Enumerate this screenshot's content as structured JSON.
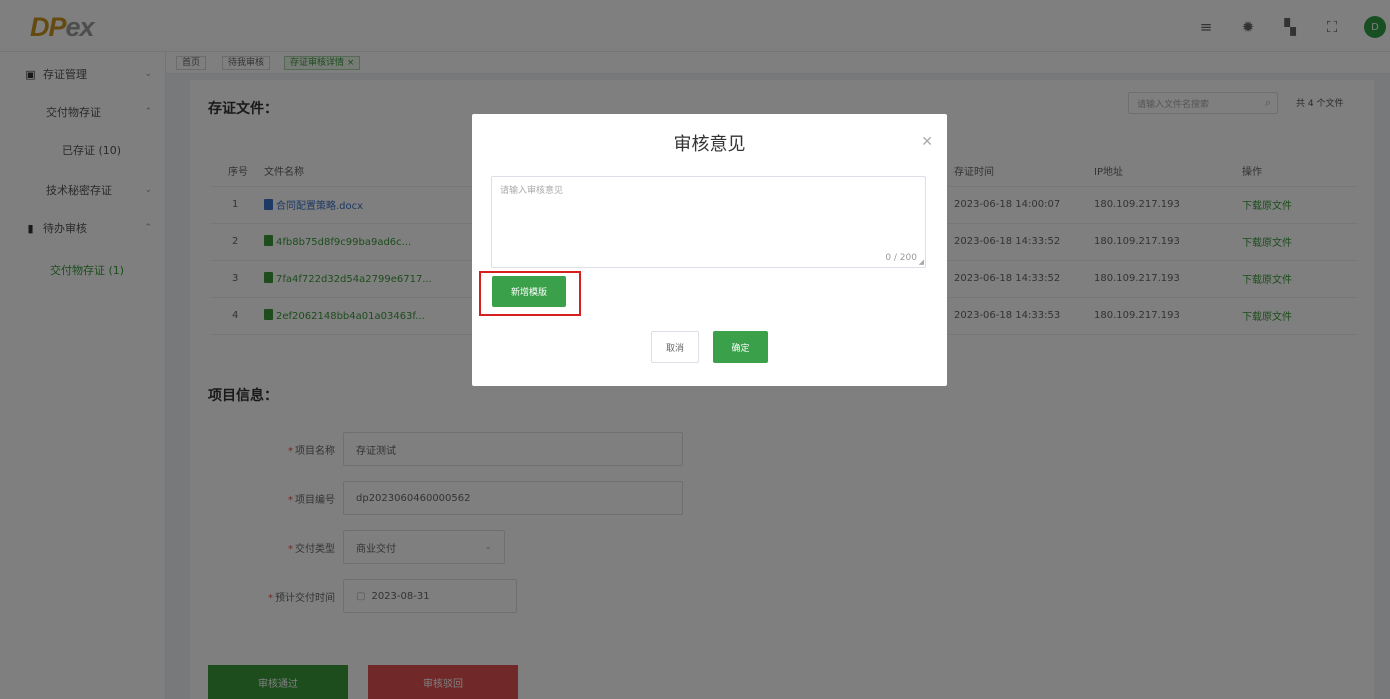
{
  "app": {
    "logo_main": "DP",
    "logo_accent": "ex"
  },
  "header": {
    "icons": [
      "menu-icon",
      "gear-icon",
      "translate-icon",
      "fullscreen-icon"
    ],
    "avatar_text": "D"
  },
  "sidebar": {
    "items": [
      {
        "label": "存证管理",
        "icon": "evidence-icon"
      },
      {
        "label": "交付物存证"
      },
      {
        "label": "已存证 (10)"
      },
      {
        "label": "技术秘密存证"
      },
      {
        "label": "待办审核",
        "icon": "clipboard-icon"
      },
      {
        "label": "交付物存证 (1)"
      }
    ]
  },
  "tags": [
    {
      "label": "首页"
    },
    {
      "label": "待我审核"
    },
    {
      "label": "存证审核详情 ×"
    }
  ],
  "files_section": {
    "title": "存证文件：",
    "search_placeholder": "请输入文件名搜索",
    "file_count": "共 4 个文件",
    "columns": [
      "序号",
      "文件名称",
      "存证时间",
      "IP地址",
      "操作"
    ],
    "rows": [
      {
        "index": "1",
        "name": "合同配置策略.docx",
        "time": "2023-06-18 14:00:07",
        "ip": "180.109.217.193",
        "action": "下载原文件",
        "icon_color": "#3a72c9",
        "name_color": "#3a72c9"
      },
      {
        "index": "2",
        "name": "4fb8b75d8f9c99ba9ad6c...",
        "time": "2023-06-18 14:33:52",
        "ip": "180.109.217.193",
        "action": "下载原文件",
        "icon_color": "#3a9a3a",
        "name_color": "#3a9a3a"
      },
      {
        "index": "3",
        "name": "7fa4f722d32d54a2799e6717...",
        "time": "2023-06-18 14:33:52",
        "ip": "180.109.217.193",
        "action": "下载原文件",
        "icon_color": "#3a9a3a",
        "name_color": "#3a9a3a"
      },
      {
        "index": "4",
        "name": "2ef2062148bb4a01a03463f...",
        "time": "2023-06-18 14:33:53",
        "ip": "180.109.217.193",
        "action": "下载原文件",
        "icon_color": "#3a9a3a",
        "name_color": "#3a9a3a"
      }
    ]
  },
  "project_section": {
    "title": "项目信息：",
    "fields": [
      {
        "label": "项目名称",
        "value": "存证测试"
      },
      {
        "label": "项目编号",
        "value": "dp2023060460000562"
      },
      {
        "label": "交付类型",
        "value": "商业交付"
      },
      {
        "label": "预计交付时间",
        "value": "2023-08-31"
      }
    ]
  },
  "footer_buttons": {
    "approve": "审核通过",
    "reject": "审核驳回"
  },
  "modal": {
    "title": "审核意见",
    "placeholder": "请输入审核意见",
    "counter": "0 / 200",
    "add_template": "新增模版",
    "cancel": "取消",
    "confirm": "确定"
  },
  "colors": {
    "primary_green": "#3aa04a",
    "danger_red": "#e05050",
    "highlight_red": "#d62020",
    "logo_gold": "#c8951f"
  }
}
